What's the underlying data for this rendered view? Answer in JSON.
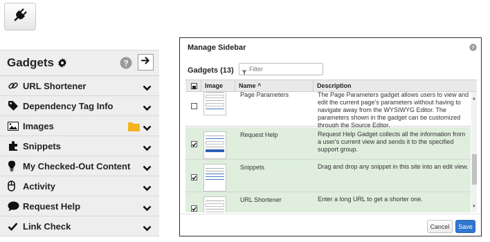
{
  "toolbar": {
    "plug_icon": "plug-icon"
  },
  "sidebar": {
    "title": "Gadgets",
    "gear_icon": "gear-icon",
    "help_icon": "question-circle-icon",
    "collapse_icon": "arrow-right-icon",
    "items": [
      {
        "label": "URL Shortener",
        "icon": "link-icon"
      },
      {
        "label": "Dependency Tag Info",
        "icon": "tag-icon"
      },
      {
        "label": "Images",
        "icon": "image-icon",
        "extra_icon": "folder-icon"
      },
      {
        "label": "Snippets",
        "icon": "puzzle-icon"
      },
      {
        "label": "My Checked-Out Content",
        "icon": "lightbulb-icon"
      },
      {
        "label": "Activity",
        "icon": "mouse-icon"
      },
      {
        "label": "Request Help",
        "icon": "comment-icon"
      },
      {
        "label": "Link Check",
        "icon": "check-icon"
      }
    ]
  },
  "modal": {
    "title": "Manage Sidebar",
    "gadget_count": "Gadgets (13)",
    "filter_placeholder": "Filter",
    "columns": {
      "image": "Image",
      "name": "Name ^",
      "description": "Description"
    },
    "rows": [
      {
        "name": "Page Parameters",
        "checked": false,
        "description": "The Page Parameters gadget allows users to view and edit the current page's parameters without having to navigate away from the WYSIWYG Editor. The parameters shown in the gadget can be customized through the Source Editor."
      },
      {
        "name": "Request Help",
        "checked": true,
        "description": "Request Help Gadget collects all the information from a user's current view and sends it to the specified support group."
      },
      {
        "name": "Snippets",
        "checked": true,
        "description": "Drag and drop any snippet in this site into an edit view."
      },
      {
        "name": "URL Shortener",
        "checked": true,
        "description": "Enter a long URL to get a shorter one."
      }
    ],
    "cancel_label": "Cancel",
    "save_label": "Save",
    "colors": {
      "selected_row": "#dfeedd",
      "primary_button": "#2f78d1",
      "folder": "#f3b51c"
    }
  }
}
